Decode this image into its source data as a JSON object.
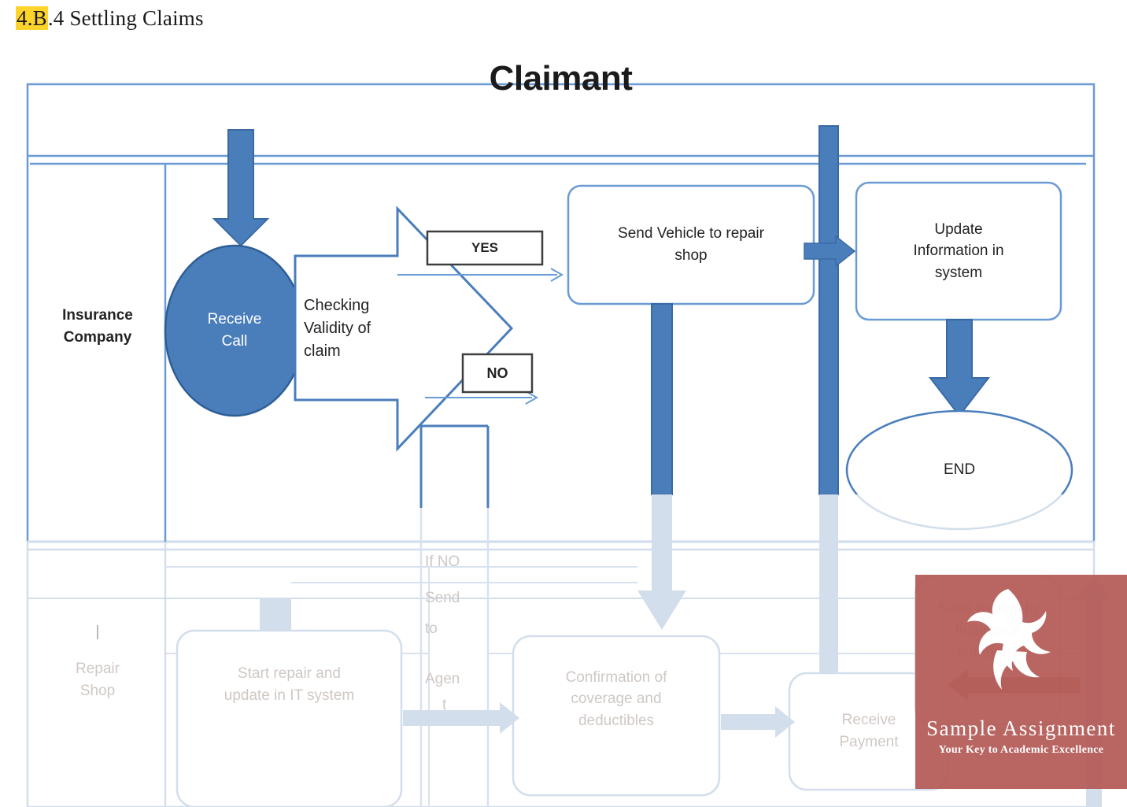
{
  "heading": {
    "highlight": "4.B",
    "rest": ".4 Settling Claims"
  },
  "diagram": {
    "type": "swimlane-flowchart",
    "header_title": "Claimant",
    "lanes": [
      {
        "id": "insurance-company",
        "label": "Insurance\nCompany"
      },
      {
        "id": "repair-shop",
        "label": "Repair\nShop",
        "prefix": "|"
      }
    ],
    "nodes": [
      {
        "id": "receive-call",
        "shape": "ellipse",
        "label": "Receive\nCall",
        "state": "solid"
      },
      {
        "id": "checking-validity",
        "shape": "right-arrow",
        "label": "Checking\nValidity of\nclaim",
        "state": "solid"
      },
      {
        "id": "yes-label",
        "shape": "rect",
        "label": "YES",
        "state": "solid"
      },
      {
        "id": "no-label",
        "shape": "rect",
        "label": "NO",
        "state": "solid"
      },
      {
        "id": "send-vehicle",
        "shape": "rounded-rect",
        "label": "Send Vehicle to repair\nshop",
        "state": "solid"
      },
      {
        "id": "update-information",
        "shape": "rounded-rect",
        "label": "Update\nInformation in\nsystem",
        "state": "solid"
      },
      {
        "id": "end",
        "shape": "ellipse",
        "label": "END",
        "state": "solid"
      },
      {
        "id": "if-no-send-to-agent",
        "shape": "open-rect",
        "label": "If NO\nSend\nto\n\nAgen\nt",
        "state": "faded"
      },
      {
        "id": "start-repair",
        "shape": "rounded-rect",
        "label": "Start repair and\nupdate in IT system",
        "state": "faded"
      },
      {
        "id": "confirmation",
        "shape": "rounded-rect",
        "label": "Confirmation of\ncoverage and\ndeductibles",
        "state": "faded"
      },
      {
        "id": "receive-payment",
        "shape": "rounded-rect",
        "label": "Receive\nPayment",
        "state": "faded"
      },
      {
        "id": "send-receipt",
        "shape": "rounded-rect",
        "label": "Send receipt to\nInsurance\ncompany",
        "state": "faded"
      }
    ],
    "node_text": {
      "receive_call_l1": "Receive",
      "receive_call_l2": "Call",
      "checking_l1": "Checking",
      "checking_l2": "Validity of",
      "checking_l3": "claim",
      "yes": "YES",
      "no": "NO",
      "send_vehicle_l1": "Send Vehicle to repair",
      "send_vehicle_l2": "shop",
      "update_info_l1": "Update",
      "update_info_l2": "Information in",
      "update_info_l3": "system",
      "end": "END",
      "ifno_l1": "If NO",
      "ifno_l2": "Send",
      "ifno_l3": "to",
      "ifno_l4": "Agen",
      "ifno_l5": "t",
      "start_repair_l1": "Start repair and",
      "start_repair_l2": "update in IT system",
      "confirmation_l1": "Confirmation of",
      "confirmation_l2": "coverage and",
      "confirmation_l3": "deductibles",
      "receive_payment_l1": "Receive",
      "receive_payment_l2": "Payment",
      "send_receipt_l1": "Send receipt to",
      "send_receipt_l2": "Insurance",
      "send_receipt_l3": "company",
      "lane_insurance_l1": "Insurance",
      "lane_insurance_l2": "Company",
      "lane_repair_pipe": "|",
      "lane_repair_l1": "Repair",
      "lane_repair_l2": "Shop"
    },
    "colors": {
      "accent_blue": "#4A7EBB",
      "lane_border": "#6A9BD4",
      "faded_blue": "#D3DEEC",
      "faded_text": "#CFC8C4",
      "label_box_border": "#3F3F3F",
      "heading_highlight": "#FFD42A"
    }
  },
  "watermark": {
    "name": "Sample Assignment",
    "tagline": "Your Key to Academic Excellence",
    "logo": "pinwheel-logo"
  }
}
